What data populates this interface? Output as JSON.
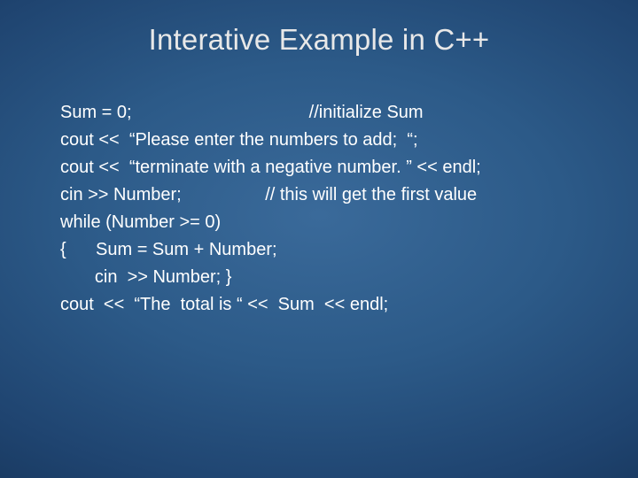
{
  "title": "Interative Example in C++",
  "code": {
    "l1": "Sum = 0;                                    //initialize Sum",
    "l2": "cout <<  “Please enter the numbers to add;  “;",
    "l3": "cout <<  “terminate with a negative number. ” << endl;",
    "l4": "cin >> Number;                 // this will get the first value",
    "l5": "while (Number >= 0)",
    "l6": "{      Sum = Sum + Number;",
    "l7": "       cin  >> Number; }",
    "l8": "cout  <<  “The  total is “ <<  Sum  << endl;"
  }
}
